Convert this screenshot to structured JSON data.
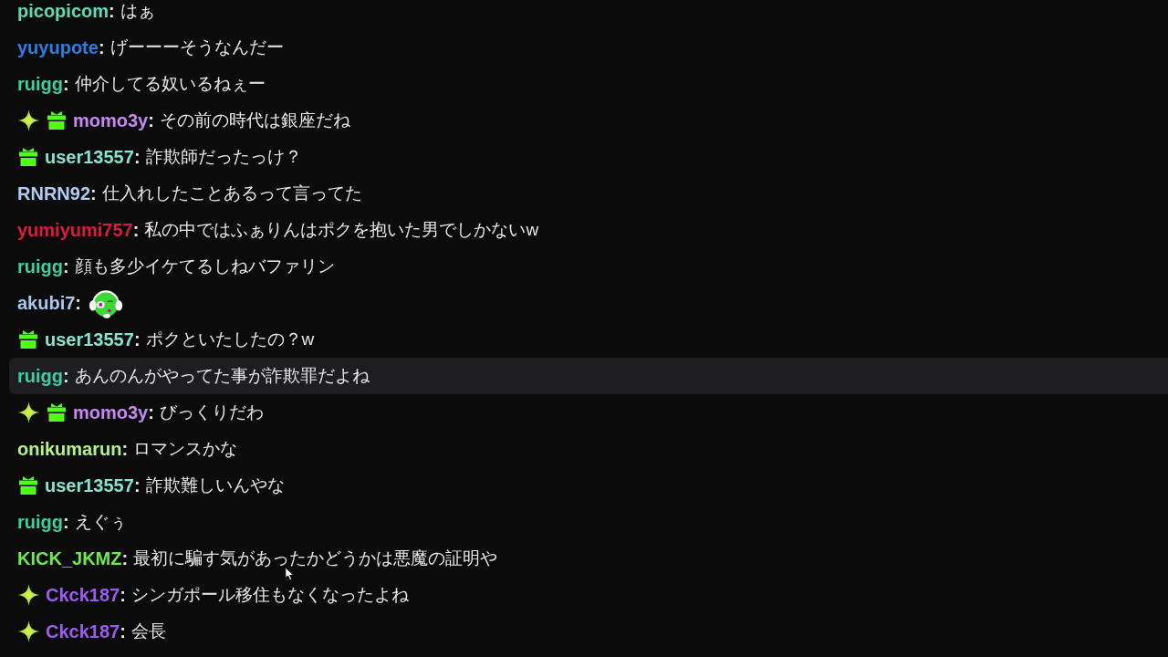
{
  "chat": {
    "messages": [
      {
        "kind": "text",
        "username": "picopicom",
        "color": "#62d9b6",
        "separator": ":",
        "text": "はぁ",
        "highlighted": false
      },
      {
        "kind": "text",
        "username": "yuyupote",
        "color": "#2e7de1",
        "separator": ":",
        "text": "げーーーそうなんだー",
        "highlighted": false
      },
      {
        "kind": "text",
        "username": "ruigg",
        "color": "#3ecf9e",
        "separator": ":",
        "text": "仲介してる奴いるねぇー",
        "highlighted": false
      },
      {
        "kind": "text",
        "badges": [
          {
            "kind": "sparkle"
          },
          {
            "kind": "gift"
          }
        ],
        "username": "momo3y",
        "color": "#c58af0",
        "separator": ":",
        "text": "その前の時代は銀座だね",
        "highlighted": false
      },
      {
        "kind": "text",
        "badges": [
          {
            "kind": "gift"
          }
        ],
        "username": "user13557",
        "color": "#86e3cf",
        "separator": ":",
        "text": "詐欺師だったっけ？",
        "highlighted": false
      },
      {
        "kind": "text",
        "username": "RNRN92",
        "color": "#b0ccf5",
        "separator": ":",
        "text": "仕入れしたことあるって言ってた",
        "highlighted": false
      },
      {
        "kind": "text",
        "username": "yumiyumi757",
        "color": "#d81c40",
        "separator": ":",
        "text": "私の中ではふぁりんはポクを抱いた男でしかないw",
        "highlighted": false
      },
      {
        "kind": "text",
        "username": "ruigg",
        "color": "#3ecf9e",
        "separator": ":",
        "text": "顔も多少イケてるしねバファリン",
        "highlighted": false
      },
      {
        "kind": "emote",
        "username": "akubi7",
        "color": "#aac8ee",
        "separator": ":",
        "highlighted": false
      },
      {
        "kind": "text",
        "badges": [
          {
            "kind": "gift"
          }
        ],
        "username": "user13557",
        "color": "#86e3cf",
        "separator": ":",
        "text": "ポクといたしたの？w",
        "highlighted": false
      },
      {
        "kind": "text",
        "username": "ruigg",
        "color": "#3ecf9e",
        "separator": ":",
        "text": "あんのんがやってた事が詐欺罪だよね",
        "highlighted": true
      },
      {
        "kind": "text",
        "badges": [
          {
            "kind": "sparkle"
          },
          {
            "kind": "gift"
          }
        ],
        "username": "momo3y",
        "color": "#c58af0",
        "separator": ":",
        "text": "びっくりだわ",
        "highlighted": false
      },
      {
        "kind": "text",
        "username": "onikumarun",
        "color": "#b5f08a",
        "separator": ":",
        "text": "ロマンスかな",
        "highlighted": false
      },
      {
        "kind": "text",
        "badges": [
          {
            "kind": "gift"
          }
        ],
        "username": "user13557",
        "color": "#86e3cf",
        "separator": ":",
        "text": "詐欺難しいんやな",
        "highlighted": false
      },
      {
        "kind": "text",
        "username": "ruigg",
        "color": "#3ecf9e",
        "separator": ":",
        "text": "えぐぅ",
        "highlighted": false
      },
      {
        "kind": "text",
        "username": "KICK_JKMZ",
        "color": "#6ee84e",
        "separator": ":",
        "text": "最初に騙す気があったかどうかは悪魔の証明や",
        "highlighted": false
      },
      {
        "kind": "text",
        "badges": [
          {
            "kind": "sparkle"
          }
        ],
        "username": "Ckck187",
        "color": "#9d5cf0",
        "separator": ":",
        "text": "シンガポール移住もなくなったよね",
        "highlighted": false
      },
      {
        "kind": "text",
        "badges": [
          {
            "kind": "sparkle"
          }
        ],
        "username": "Ckck187",
        "color": "#9d5cf0",
        "separator": ":",
        "text": "会長",
        "highlighted": false
      }
    ]
  }
}
